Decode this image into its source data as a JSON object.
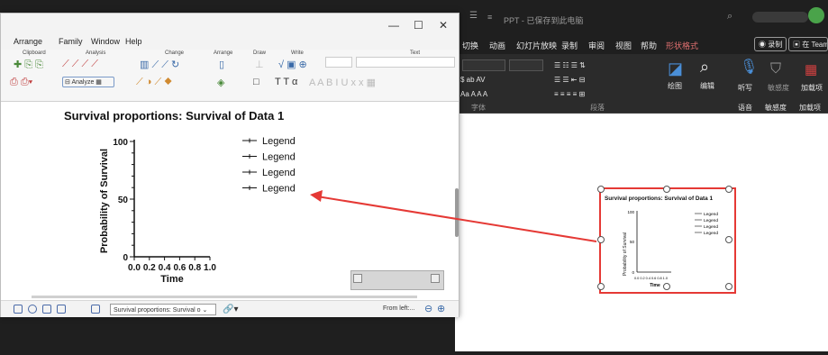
{
  "powerpoint": {
    "title": "PPT - 已保存到此电脑",
    "tabs": [
      "切换",
      "动画",
      "幻灯片放映",
      "录制",
      "审阅",
      "视图",
      "帮助",
      "形状格式"
    ],
    "record_label": "录制",
    "share_label": "在 Team",
    "ribbon": {
      "font_group": "字体",
      "paragraph_group": "段落",
      "draw_label": "绘图",
      "edit_label": "编辑",
      "dictate_label": "听写",
      "sensitivity_label": "敏感度",
      "addins_label": "加载项",
      "voice_group": "语音",
      "sensitivity_group": "敏感度",
      "addins_group": "加载项"
    }
  },
  "slide_chart": {
    "title": "Survival proportions: Survival of Data 1",
    "ylabel": "Probability of Survival",
    "xlabel": "Time",
    "yticks": [
      "100",
      "50",
      "0"
    ],
    "xticks": "0.0 0.2 0.4 0.6 0.8 1.0",
    "legend": [
      "Legend",
      "Legend",
      "Legend",
      "Legend"
    ]
  },
  "prism": {
    "menu": [
      "Arrange",
      "Family",
      "Window",
      "Help"
    ],
    "groups": [
      "Clipboard",
      "Analysis",
      "Change",
      "Arrange",
      "Draw",
      "Write",
      "Text"
    ],
    "analyze_label": "Analyze",
    "chart_selector_value": "Survival proportions: Survival o",
    "from_left_label": "From left:..."
  },
  "chart_data": {
    "type": "line",
    "title": "Survival proportions: Survival of Data 1",
    "xlabel": "Time",
    "ylabel": "Probability of Survival",
    "x_ticks": [
      "0.0",
      "0.2",
      "0.4",
      "0.6",
      "0.8",
      "1.0"
    ],
    "y_ticks": [
      "0",
      "50",
      "100"
    ],
    "xlim": [
      0,
      1
    ],
    "ylim": [
      0,
      100
    ],
    "series": [
      {
        "name": "Legend",
        "values": []
      },
      {
        "name": "Legend",
        "values": []
      },
      {
        "name": "Legend",
        "values": []
      },
      {
        "name": "Legend",
        "values": []
      }
    ],
    "legend_position": "top-right",
    "grid": false
  }
}
